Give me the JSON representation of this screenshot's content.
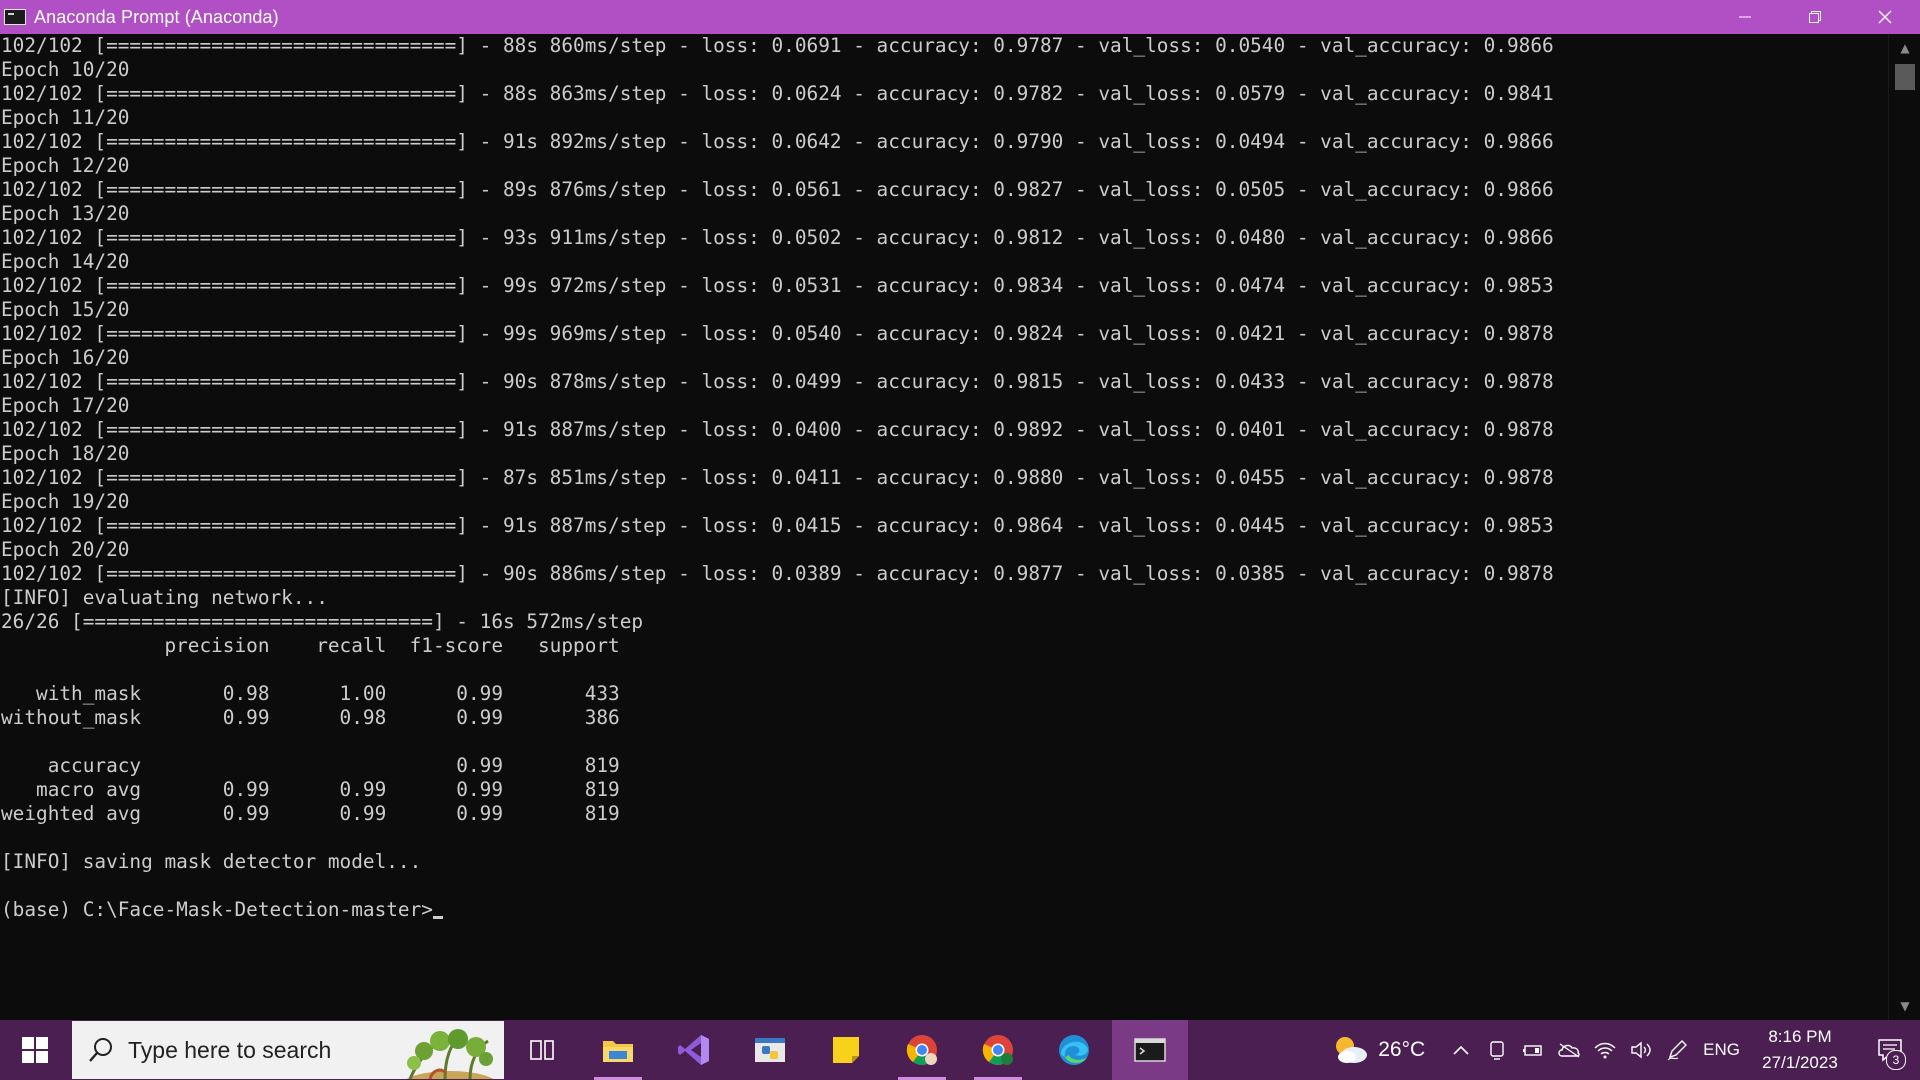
{
  "window": {
    "title": "Anaconda Prompt (Anaconda)",
    "buttons": {
      "minimize": "minimize",
      "maximize": "restore",
      "close": "close"
    }
  },
  "console": {
    "lines": [
      "102/102 [==============================] - 88s 860ms/step - loss: 0.0691 - accuracy: 0.9787 - val_loss: 0.0540 - val_accuracy: 0.9866",
      "Epoch 10/20",
      "102/102 [==============================] - 88s 863ms/step - loss: 0.0624 - accuracy: 0.9782 - val_loss: 0.0579 - val_accuracy: 0.9841",
      "Epoch 11/20",
      "102/102 [==============================] - 91s 892ms/step - loss: 0.0642 - accuracy: 0.9790 - val_loss: 0.0494 - val_accuracy: 0.9866",
      "Epoch 12/20",
      "102/102 [==============================] - 89s 876ms/step - loss: 0.0561 - accuracy: 0.9827 - val_loss: 0.0505 - val_accuracy: 0.9866",
      "Epoch 13/20",
      "102/102 [==============================] - 93s 911ms/step - loss: 0.0502 - accuracy: 0.9812 - val_loss: 0.0480 - val_accuracy: 0.9866",
      "Epoch 14/20",
      "102/102 [==============================] - 99s 972ms/step - loss: 0.0531 - accuracy: 0.9834 - val_loss: 0.0474 - val_accuracy: 0.9853",
      "Epoch 15/20",
      "102/102 [==============================] - 99s 969ms/step - loss: 0.0540 - accuracy: 0.9824 - val_loss: 0.0421 - val_accuracy: 0.9878",
      "Epoch 16/20",
      "102/102 [==============================] - 90s 878ms/step - loss: 0.0499 - accuracy: 0.9815 - val_loss: 0.0433 - val_accuracy: 0.9878",
      "Epoch 17/20",
      "102/102 [==============================] - 91s 887ms/step - loss: 0.0400 - accuracy: 0.9892 - val_loss: 0.0401 - val_accuracy: 0.9878",
      "Epoch 18/20",
      "102/102 [==============================] - 87s 851ms/step - loss: 0.0411 - accuracy: 0.9880 - val_loss: 0.0455 - val_accuracy: 0.9878",
      "Epoch 19/20",
      "102/102 [==============================] - 91s 887ms/step - loss: 0.0415 - accuracy: 0.9864 - val_loss: 0.0445 - val_accuracy: 0.9853",
      "Epoch 20/20",
      "102/102 [==============================] - 90s 886ms/step - loss: 0.0389 - accuracy: 0.9877 - val_loss: 0.0385 - val_accuracy: 0.9878",
      "[INFO] evaluating network...",
      "26/26 [==============================] - 16s 572ms/step",
      "              precision    recall  f1-score   support",
      "",
      "   with_mask       0.98      1.00      0.99       433",
      "without_mask       0.99      0.98      0.99       386",
      "",
      "    accuracy                           0.99       819",
      "   macro avg       0.99      0.99      0.99       819",
      "weighted avg       0.99      0.99      0.99       819",
      "",
      "[INFO] saving mask detector model...",
      ""
    ],
    "prompt": "(base) C:\\Face-Mask-Detection-master>"
  },
  "taskbar": {
    "search_placeholder": "Type here to search",
    "apps": [
      "task-view",
      "file-explorer",
      "visual-studio",
      "python",
      "sticky-notes",
      "chrome",
      "chrome-profile",
      "edge",
      "terminal"
    ],
    "weather_temp": "26°C",
    "language": "ENG",
    "time": "8:16 PM",
    "date": "27/1/2023",
    "notification_count": "3"
  }
}
